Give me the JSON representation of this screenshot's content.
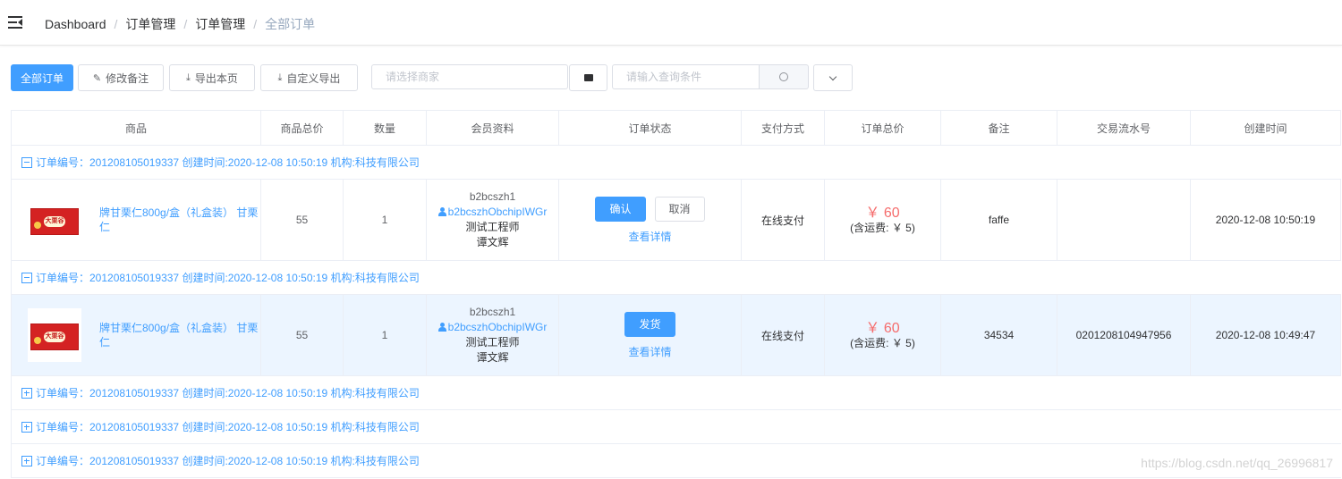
{
  "breadcrumb": [
    "Dashboard",
    "订单管理",
    "订单管理",
    "全部订单"
  ],
  "toolbar": {
    "all_orders": "全部订单",
    "edit_note": "修改备注",
    "export_page": "导出本页",
    "custom_export": "自定义导出",
    "merchant_placeholder": "请选择商家",
    "query_placeholder": "请输入查询条件"
  },
  "columns": [
    "商品",
    "商品总价",
    "数量",
    "会员资料",
    "订单状态",
    "支付方式",
    "订单总价",
    "备注",
    "交易流水号",
    "创建时间"
  ],
  "group_label": "订单编号：201208105019337 创建时间:2020-12-08 10:50:19 机构:科技有限公司",
  "orders": [
    {
      "product": "牌甘栗仁800g/盒（礼盒装） 甘栗仁",
      "product_total": "55",
      "qty": "1",
      "member_user": "b2bcszh1",
      "member_link": "b2bcszhObchipIWGr",
      "member_title": "测试工程师",
      "member_name": "谭文辉",
      "action_confirm": "确认",
      "action_cancel": "取消",
      "detail": "查看详情",
      "payment": "在线支付",
      "price": "￥ 60",
      "shipping": "(含运费: ￥ 5)",
      "note": "faffe",
      "txn": "",
      "created": "2020-12-08 10:50:19"
    },
    {
      "product": "牌甘栗仁800g/盒（礼盒装） 甘栗仁",
      "product_total": "55",
      "qty": "1",
      "member_user": "b2bcszh1",
      "member_link": "b2bcszhObchipIWGr",
      "member_title": "测试工程师",
      "member_name": "谭文辉",
      "action_ship": "发货",
      "detail": "查看详情",
      "payment": "在线支付",
      "price": "￥ 60",
      "shipping": "(含运费: ￥ 5)",
      "note": "34534",
      "txn": "0201208104947956",
      "created": "2020-12-08 10:49:47"
    }
  ],
  "product_box_label": "大栗谷",
  "watermark": "https://blog.csdn.net/qq_26996817"
}
